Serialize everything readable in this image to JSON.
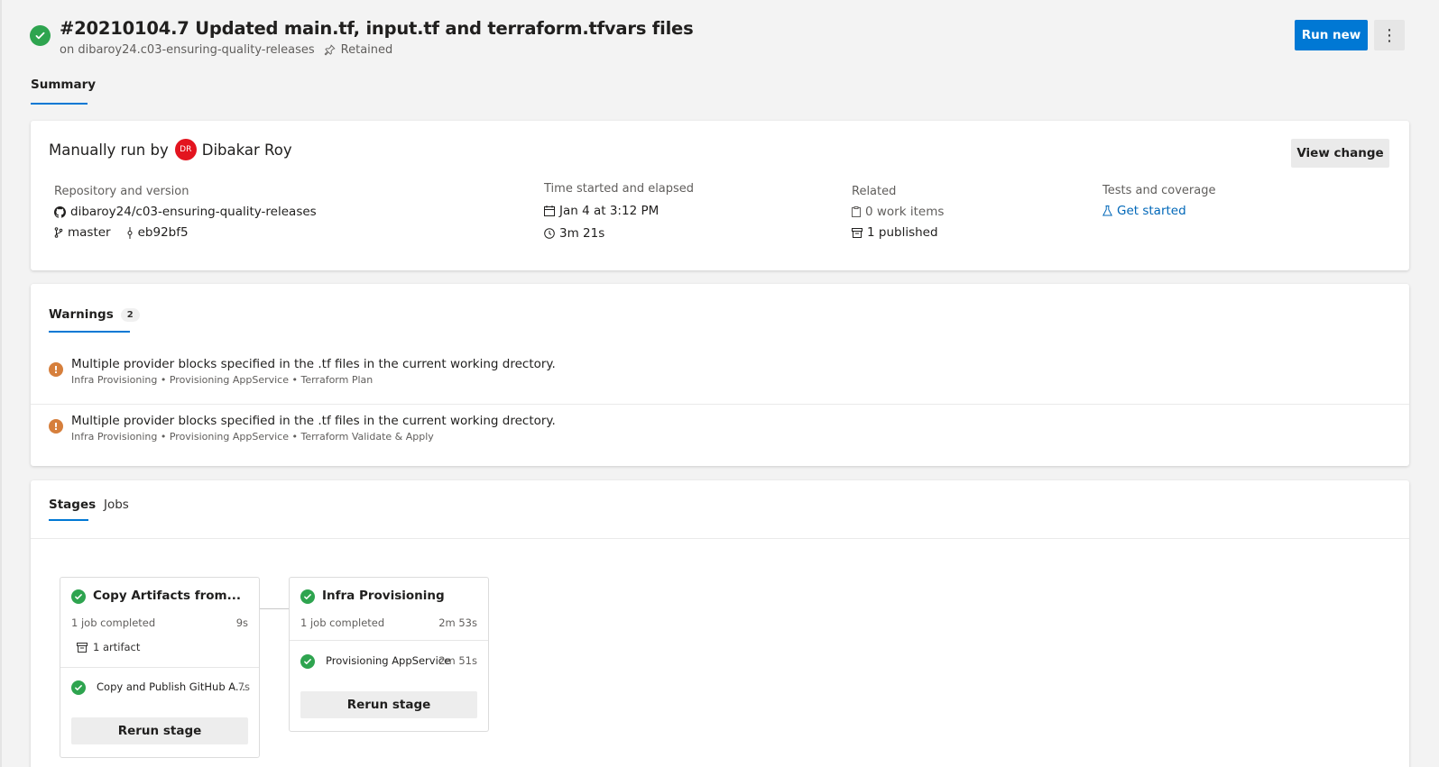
{
  "header": {
    "title": "#20210104.7 Updated main.tf, input.tf and terraform.tfvars files",
    "repo_prefix": "on dibaroy24.c03-ensuring-quality-releases",
    "retained": "Retained",
    "run_new": "Run new",
    "more": "⋮",
    "tab_summary": "Summary"
  },
  "summary": {
    "manually_run_by": "Manually run by",
    "avatar_initials": "DR",
    "user": "Dibakar Roy",
    "view_change": "View change",
    "repo_label": "Repository and version",
    "repo": "dibaroy24/c03-ensuring-quality-releases",
    "branch": "master",
    "commit": "eb92bf5",
    "time_label": "Time started and elapsed",
    "started": "Jan 4 at 3:12 PM",
    "elapsed": "3m 21s",
    "related_label": "Related",
    "work_items": "0 work items",
    "published": "1 published",
    "tests_label": "Tests and coverage",
    "get_started": "Get started"
  },
  "warnings": {
    "tab": "Warnings",
    "count": "2",
    "items": [
      {
        "message": "Multiple provider blocks specified in the .tf files in the current working drectory.",
        "path": "Infra Provisioning • Provisioning AppService • Terraform Plan"
      },
      {
        "message": "Multiple provider blocks specified in the .tf files in the current working drectory.",
        "path": "Infra Provisioning • Provisioning AppService • Terraform Validate & Apply"
      }
    ]
  },
  "stages": {
    "tab_stages": "Stages",
    "tab_jobs": "Jobs",
    "items": [
      {
        "title": "Copy Artifacts from...",
        "meta": "1 job completed",
        "duration": "9s",
        "artifact": "1 artifact",
        "job": "Copy and Publish GitHub A...",
        "job_duration": "7s",
        "rerun": "Rerun stage"
      },
      {
        "title": "Infra Provisioning",
        "meta": "1 job completed",
        "duration": "2m 53s",
        "job": "Provisioning AppService",
        "job_duration": "2m 51s",
        "rerun": "Rerun stage"
      }
    ]
  },
  "colors": {
    "accent": "#0078d4",
    "success": "#2ea44f",
    "warning": "#d67f3c",
    "avatar": "#e3141f"
  }
}
